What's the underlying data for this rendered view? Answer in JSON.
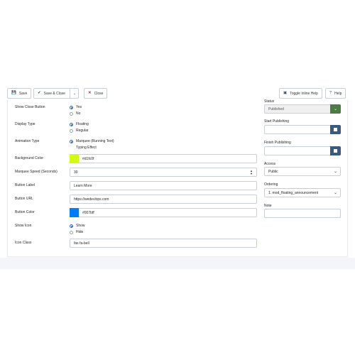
{
  "toolbar": {
    "save_label": "Save",
    "save_close_label": "Save & Close",
    "close_label": "Close",
    "toggle_help_label": "Toggle Inline Help",
    "help_label": "Help"
  },
  "form": {
    "show_close_button": {
      "label": "Show Close Button",
      "options": [
        "Yes",
        "No"
      ],
      "selected": "Yes"
    },
    "display_type": {
      "label": "Display Type",
      "options": [
        "Floating",
        "Regular"
      ],
      "selected": "Floating"
    },
    "animation_type": {
      "label": "Animation Type",
      "options": [
        "Marquee (Running Text)",
        "Typing Effect"
      ],
      "selected": "Marquee (Running Text)"
    },
    "background_color": {
      "label": "Background Color",
      "value": "#d1fc0f",
      "color": "#d1fc0f"
    },
    "marquee_speed": {
      "label": "Marquee Speed (Seconds)",
      "value": "30"
    },
    "button_label": {
      "label": "Button Label",
      "value": "Learn More"
    },
    "button_url": {
      "label": "Button URL",
      "value": "https://wedevlops.com"
    },
    "button_color": {
      "label": "Button Color",
      "value": "#007bff",
      "color": "#007bff"
    },
    "show_icon": {
      "label": "Show Icon",
      "options": [
        "Show",
        "Hide"
      ],
      "selected": "Show"
    },
    "icon_class": {
      "label": "Icon Class",
      "value": "fas fa-bell"
    }
  },
  "sidebar": {
    "status": {
      "label": "Status",
      "value": "Published"
    },
    "start_publishing": {
      "label": "Start Publishing",
      "value": ""
    },
    "finish_publishing": {
      "label": "Finish Publishing",
      "value": ""
    },
    "access": {
      "label": "Access",
      "value": "Public"
    },
    "ordering": {
      "label": "Ordering",
      "value": "1. mod_floating_announcement"
    },
    "note": {
      "label": "Note",
      "value": ""
    }
  },
  "icons": {
    "save": "floppy-icon",
    "save_close": "check-icon",
    "close": "close-icon",
    "toggle_help": "help-toggle-icon",
    "help": "question-icon",
    "calendar": "calendar-icon",
    "dropdown": "chevron-down-icon"
  },
  "colors": {
    "status_button": "#4a7d42",
    "calendar_button": "#3a5a80",
    "close_icon": "#c52827",
    "radio_selected": "#2a69b8"
  }
}
